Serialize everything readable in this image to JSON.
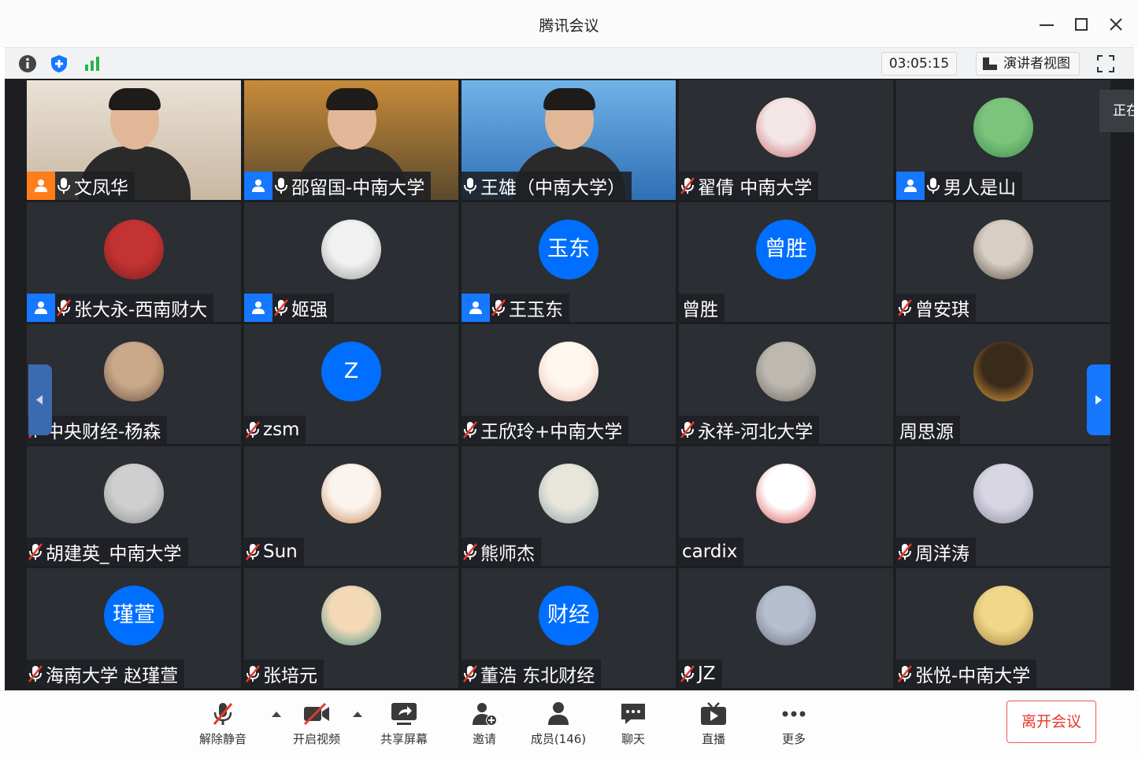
{
  "window": {
    "title": "腾讯会议"
  },
  "toolbar": {
    "timer": "03:05:15",
    "view_label": "演讲者视图"
  },
  "side_tab": {
    "label": "正在"
  },
  "participants": [
    {
      "name": "文凤华",
      "host": "orange",
      "mic": "on",
      "avatar": "video"
    },
    {
      "name": "邵留国-中南大学",
      "host": "blue",
      "mic": "on",
      "avatar": "video"
    },
    {
      "name": "王雄（中南大学）",
      "host": "",
      "mic": "on",
      "avatar": "video"
    },
    {
      "name": "翟倩 中南大学",
      "host": "",
      "mic": "muted",
      "avatar": "image"
    },
    {
      "name": "男人是山",
      "host": "blue",
      "mic": "on",
      "avatar": "image"
    },
    {
      "name": "张大永-西南财大",
      "host": "blue",
      "mic": "muted",
      "avatar": "image"
    },
    {
      "name": "姬强",
      "host": "blue",
      "mic": "muted",
      "avatar": "image"
    },
    {
      "name": "王玉东",
      "host": "blue",
      "mic": "muted",
      "avatar": "text",
      "avatar_text": "玉东"
    },
    {
      "name": "曾胜",
      "host": "",
      "mic": "none",
      "avatar": "text",
      "avatar_text": "曾胜"
    },
    {
      "name": "曾安琪",
      "host": "",
      "mic": "muted",
      "avatar": "image"
    },
    {
      "name": "中央财经-杨森",
      "host": "",
      "mic": "muted",
      "avatar": "image"
    },
    {
      "name": "zsm",
      "host": "",
      "mic": "muted",
      "avatar": "text",
      "avatar_text": "Z"
    },
    {
      "name": "王欣玲+中南大学",
      "host": "",
      "mic": "muted",
      "avatar": "image"
    },
    {
      "name": "永祥-河北大学",
      "host": "",
      "mic": "muted",
      "avatar": "image"
    },
    {
      "name": "周思源",
      "host": "",
      "mic": "none",
      "avatar": "image"
    },
    {
      "name": "胡建英_中南大学",
      "host": "",
      "mic": "muted",
      "avatar": "image"
    },
    {
      "name": "Sun",
      "host": "",
      "mic": "muted",
      "avatar": "image"
    },
    {
      "name": "熊师杰",
      "host": "",
      "mic": "muted",
      "avatar": "image"
    },
    {
      "name": "cardix",
      "host": "",
      "mic": "none",
      "avatar": "image"
    },
    {
      "name": "周洋涛",
      "host": "",
      "mic": "muted",
      "avatar": "image"
    },
    {
      "name": "海南大学 赵瑾萱",
      "host": "",
      "mic": "muted",
      "avatar": "text",
      "avatar_text": "瑾萱"
    },
    {
      "name": "张培元",
      "host": "",
      "mic": "muted",
      "avatar": "image"
    },
    {
      "name": "董浩 东北财经",
      "host": "",
      "mic": "muted",
      "avatar": "text",
      "avatar_text": "财经"
    },
    {
      "name": "JZ",
      "host": "",
      "mic": "muted",
      "avatar": "image"
    },
    {
      "name": "张悦-中南大学",
      "host": "",
      "mic": "muted",
      "avatar": "image"
    }
  ],
  "controls": {
    "unmute": "解除静音",
    "start_video": "开启视频",
    "share_screen": "共享屏幕",
    "invite": "邀请",
    "members": "成员(146)",
    "chat": "聊天",
    "live": "直播",
    "more": "更多",
    "leave": "离开会议"
  },
  "colors": {
    "accent": "#1677ff",
    "host_orange": "#ff7d1a",
    "leave_red": "#e8382b",
    "tile_bg": "#2b2e33"
  }
}
